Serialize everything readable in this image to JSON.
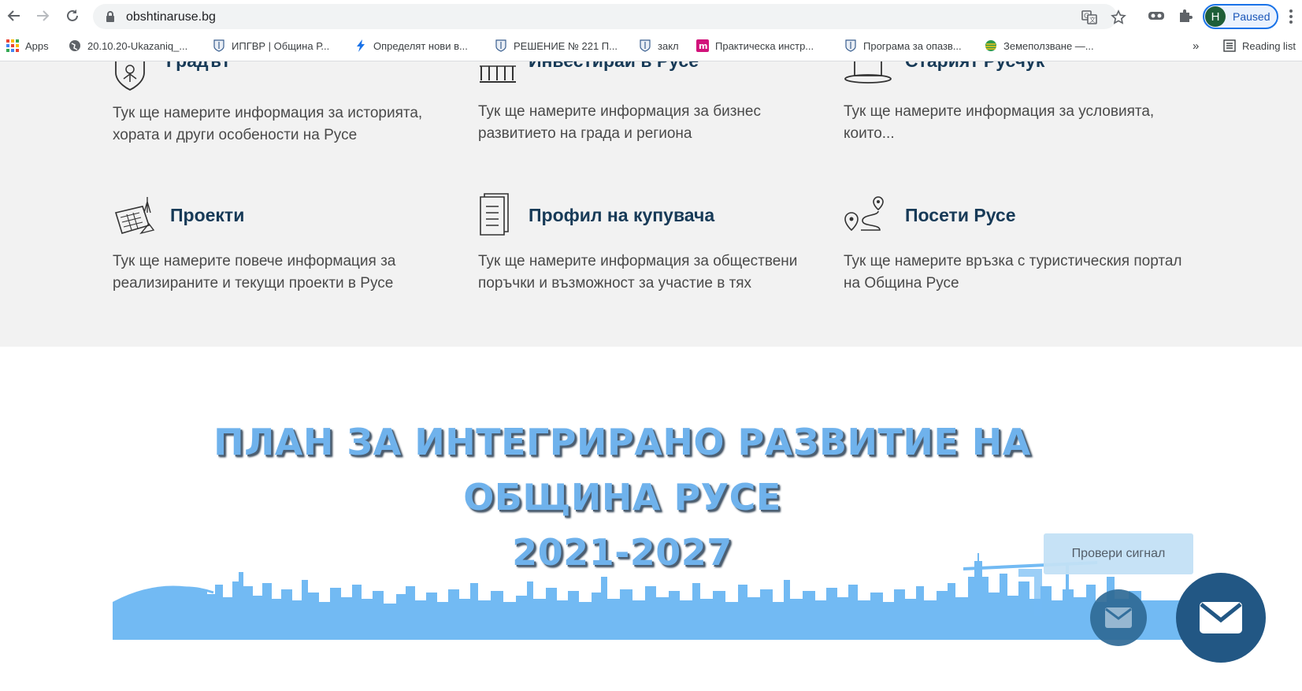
{
  "browser": {
    "url": "obshtinaruse.bg",
    "profile_initial": "H",
    "profile_status": "Paused",
    "bookmarks": [
      {
        "label": "Apps",
        "icon": "apps-grid-icon"
      },
      {
        "label": "20.10.20-Ukazaniq_...",
        "icon": "globe-icon"
      },
      {
        "label": "ИПГВР | Община Р...",
        "icon": "ruse-crest-icon"
      },
      {
        "label": "Определят нови в...",
        "icon": "bolt-icon"
      },
      {
        "label": "РЕШЕНИЕ № 221 П...",
        "icon": "ruse-crest-icon"
      },
      {
        "label": "закл",
        "icon": "ruse-crest-icon"
      },
      {
        "label": "Практическа инстр...",
        "icon": "m-logo-icon"
      },
      {
        "label": "Програма за опазв...",
        "icon": "ruse-crest-icon"
      },
      {
        "label": "Земеползване —...",
        "icon": "globe-stripes-icon"
      }
    ],
    "bookmarks_more": "»",
    "reading_list": "Reading list"
  },
  "cards": [
    {
      "title": "Градът",
      "desc": "Тук ще намерите информация за историята, хората и други особености на Русе",
      "icon": "crest-icon"
    },
    {
      "title": "Инвестирай в Русе",
      "desc": "Тук ще намерите информация за бизнес развитието на града и региона",
      "icon": "columns-icon"
    },
    {
      "title": "Старият Русчук",
      "desc": "Тук ще намерите информация за условията, които...",
      "icon": "hat-icon"
    },
    {
      "title": "Проекти",
      "desc": "Тук ще намерите повече информация за реализираните и текущи проекти в Русе",
      "icon": "blueprint-icon"
    },
    {
      "title": "Профил на купувача",
      "desc": "Тук ще намерите информация за обществени поръчки и възможност за участие в тях",
      "icon": "document-icon"
    },
    {
      "title": "Посети Русе",
      "desc": "Тук ще намерите връзка с туристическия портал на Община Русе",
      "icon": "route-pin-icon"
    }
  ],
  "plan": {
    "line1": "ПЛАН ЗА ИНТЕГРИРАНО РАЗВИТИЕ НА",
    "line2": "ОБЩИНА РУСЕ",
    "line3": "2021-2027"
  },
  "widgets": {
    "signal_label": "Провери сигнал"
  },
  "colors": {
    "title_blue": "#173a57",
    "skyline_blue": "#72baf3",
    "mail_button": "#225784"
  }
}
